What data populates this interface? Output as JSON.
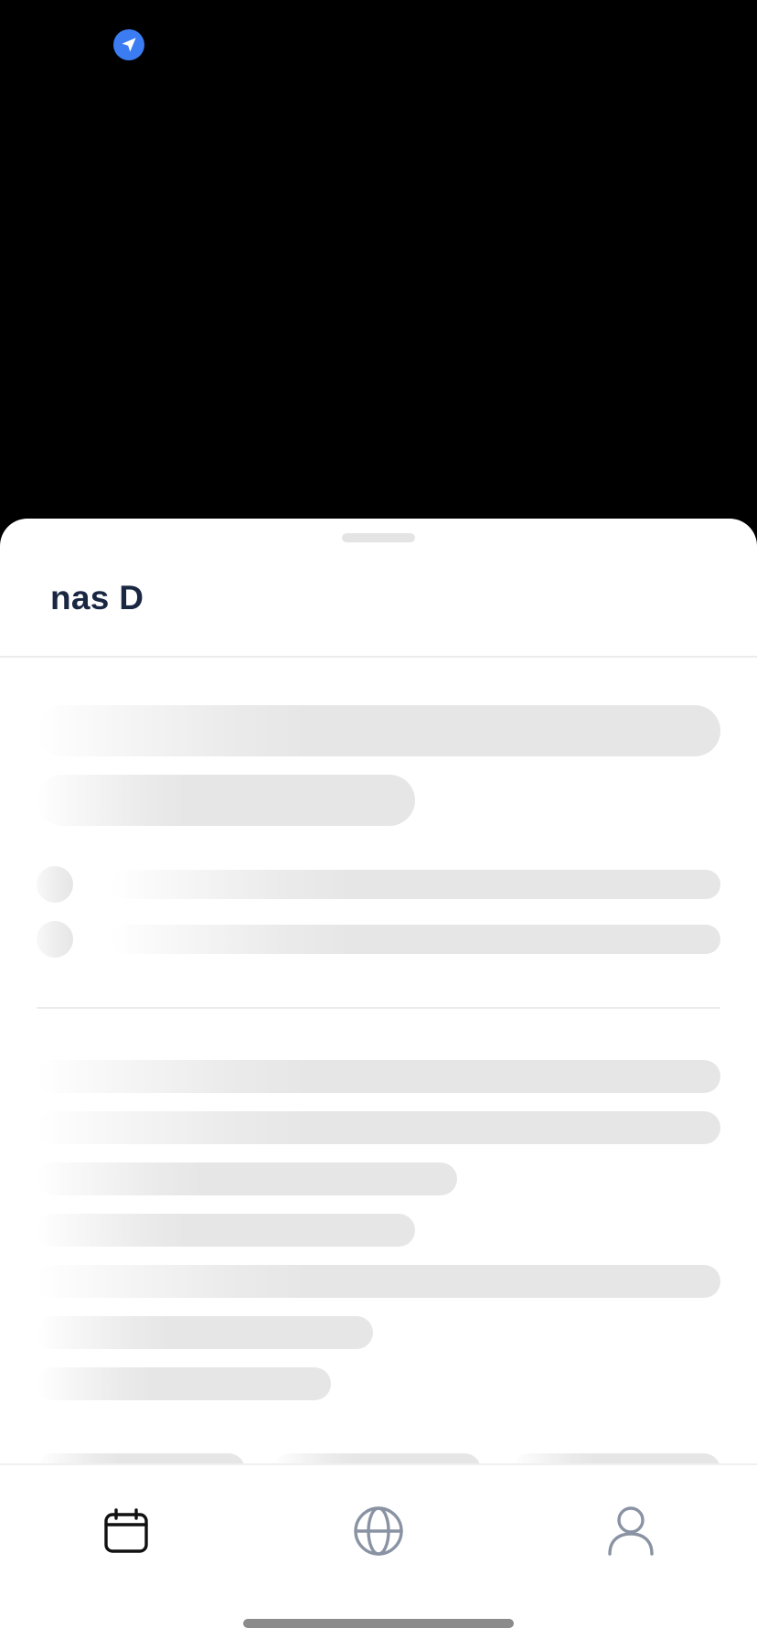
{
  "sheet": {
    "title": "nas D"
  },
  "colors": {
    "location_accent": "#3b7cf2",
    "title_text": "#1a2742",
    "active_tab": "#111111",
    "inactive_tab": "#8a93a3"
  },
  "tab_bar": {
    "items": [
      {
        "icon": "calendar-icon",
        "active": true
      },
      {
        "icon": "globe-icon",
        "active": false
      },
      {
        "icon": "profile-icon",
        "active": false
      }
    ]
  }
}
